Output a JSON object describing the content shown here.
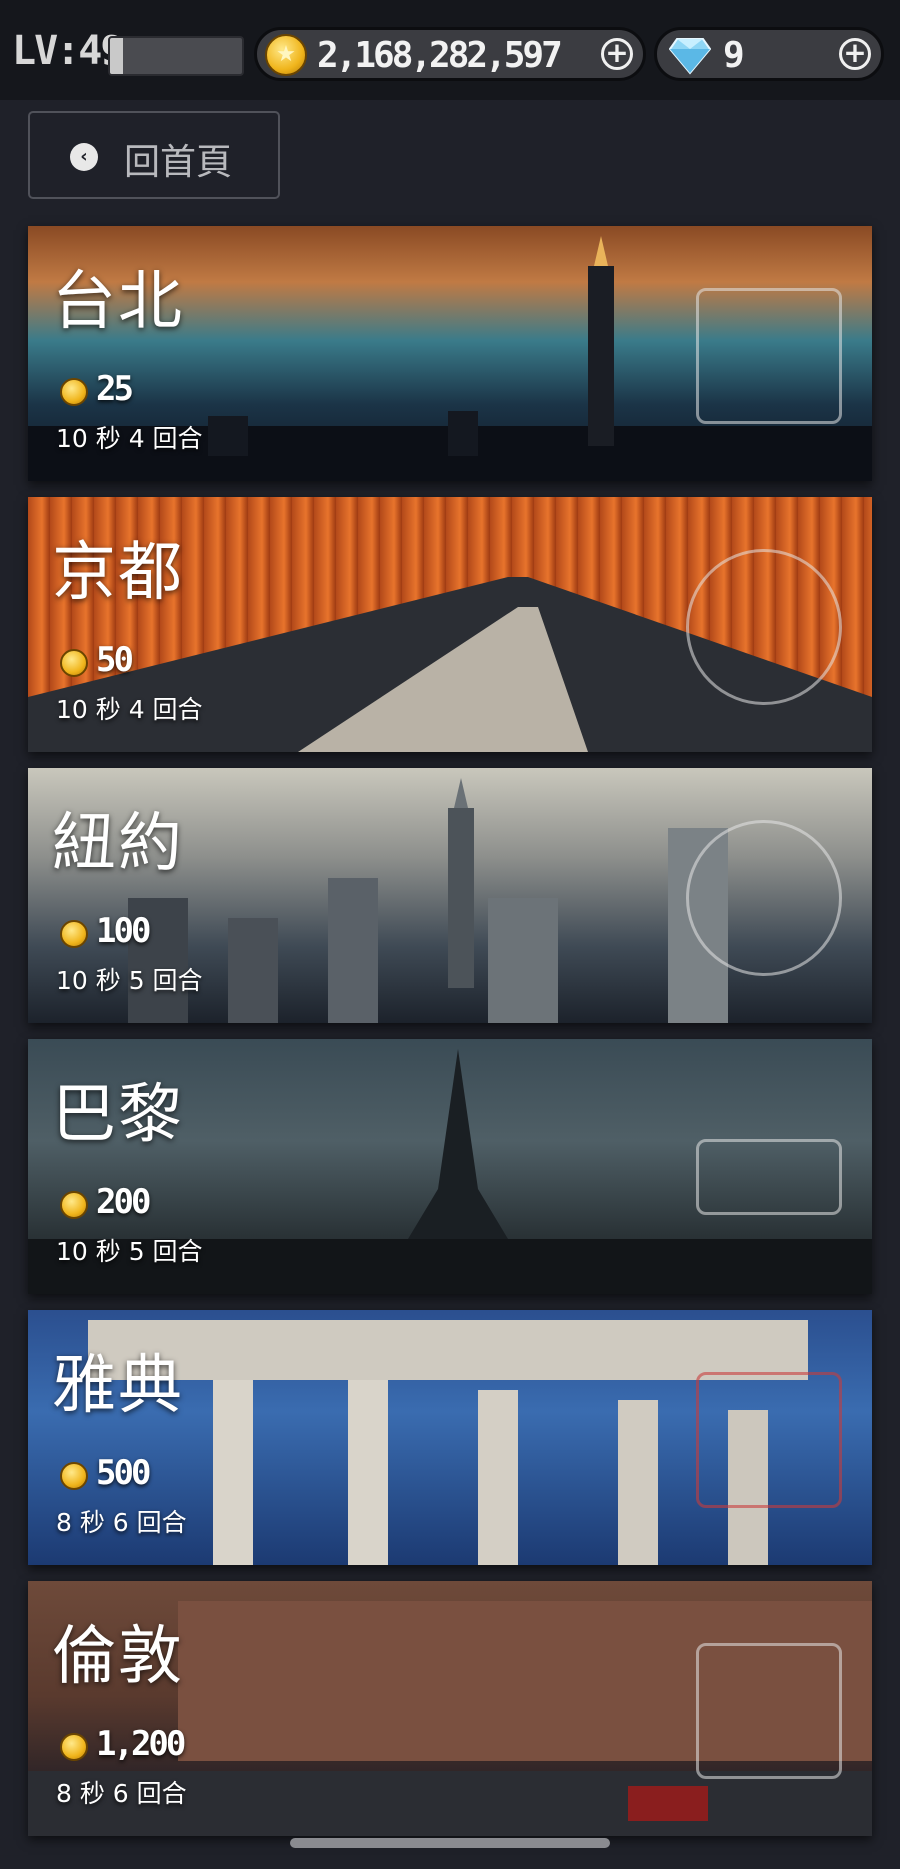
{
  "header": {
    "level_label": "LV:49",
    "level_progress": 0.1,
    "coins": "2,168,282,597",
    "gems": "9"
  },
  "nav": {
    "back_label": "回首頁"
  },
  "cities": [
    {
      "name": "台北",
      "cost": "25",
      "rule": "10 秒 4 回合"
    },
    {
      "name": "京都",
      "cost": "50",
      "rule": "10 秒 4 回合"
    },
    {
      "name": "紐約",
      "cost": "100",
      "rule": "10 秒 5 回合"
    },
    {
      "name": "巴黎",
      "cost": "200",
      "rule": "10 秒 5 回合"
    },
    {
      "name": "雅典",
      "cost": "500",
      "rule": "8 秒 6 回合"
    },
    {
      "name": "倫敦",
      "cost": "1,200",
      "rule": "8 秒 6 回合"
    }
  ],
  "icons": {
    "coin": "coin-icon",
    "gem": "diamond-icon",
    "plus": "plus-icon",
    "back": "chevron-left-icon"
  }
}
